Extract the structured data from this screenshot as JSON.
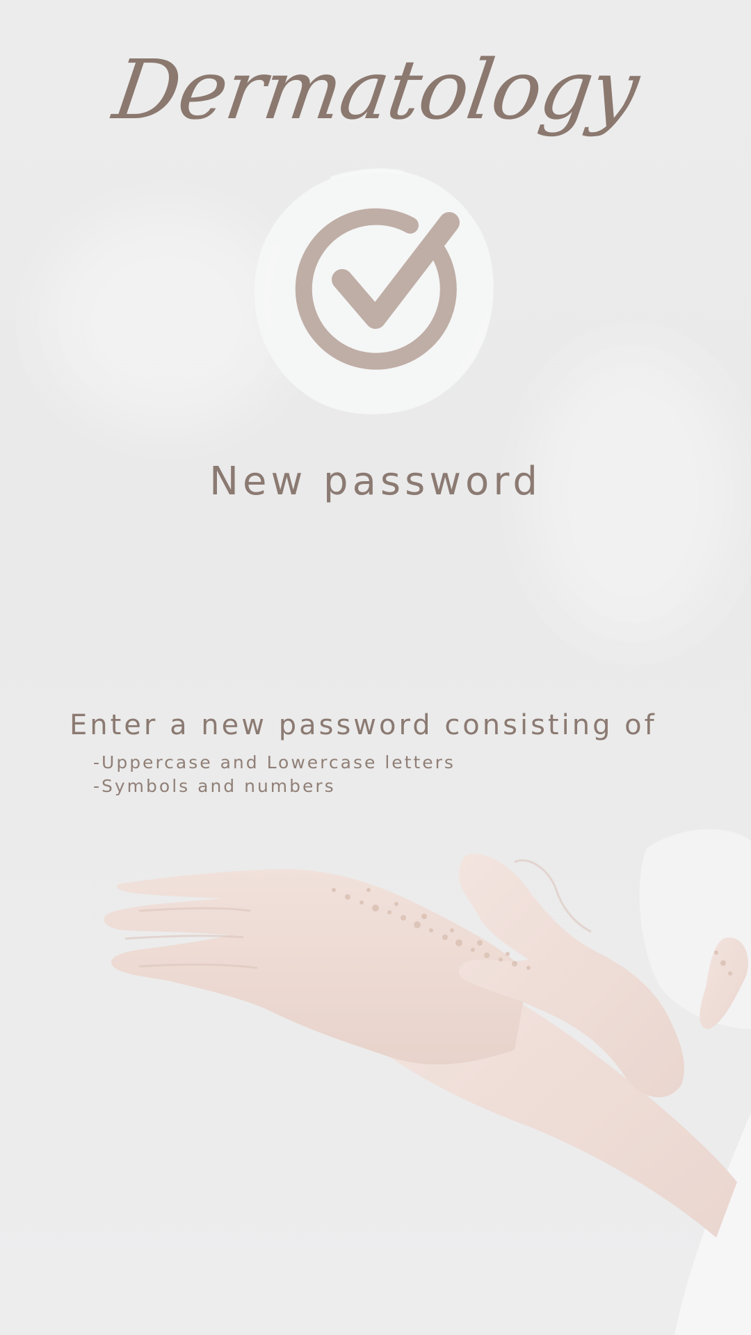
{
  "brand": {
    "logo_text": "Dermatology"
  },
  "status_icon": "check-circle-icon",
  "page": {
    "title": "New password"
  },
  "instructions": {
    "heading": "Enter a new password consisting of",
    "requirements": [
      "-Uppercase and Lowercase letters",
      "-Symbols and numbers"
    ]
  },
  "background_image": "hands-applying-scrub-photo",
  "colors": {
    "accent": "#8b7a72",
    "icon": "#bfaea6",
    "badge_bg": "#f5f6f6",
    "background": "#ececec"
  }
}
